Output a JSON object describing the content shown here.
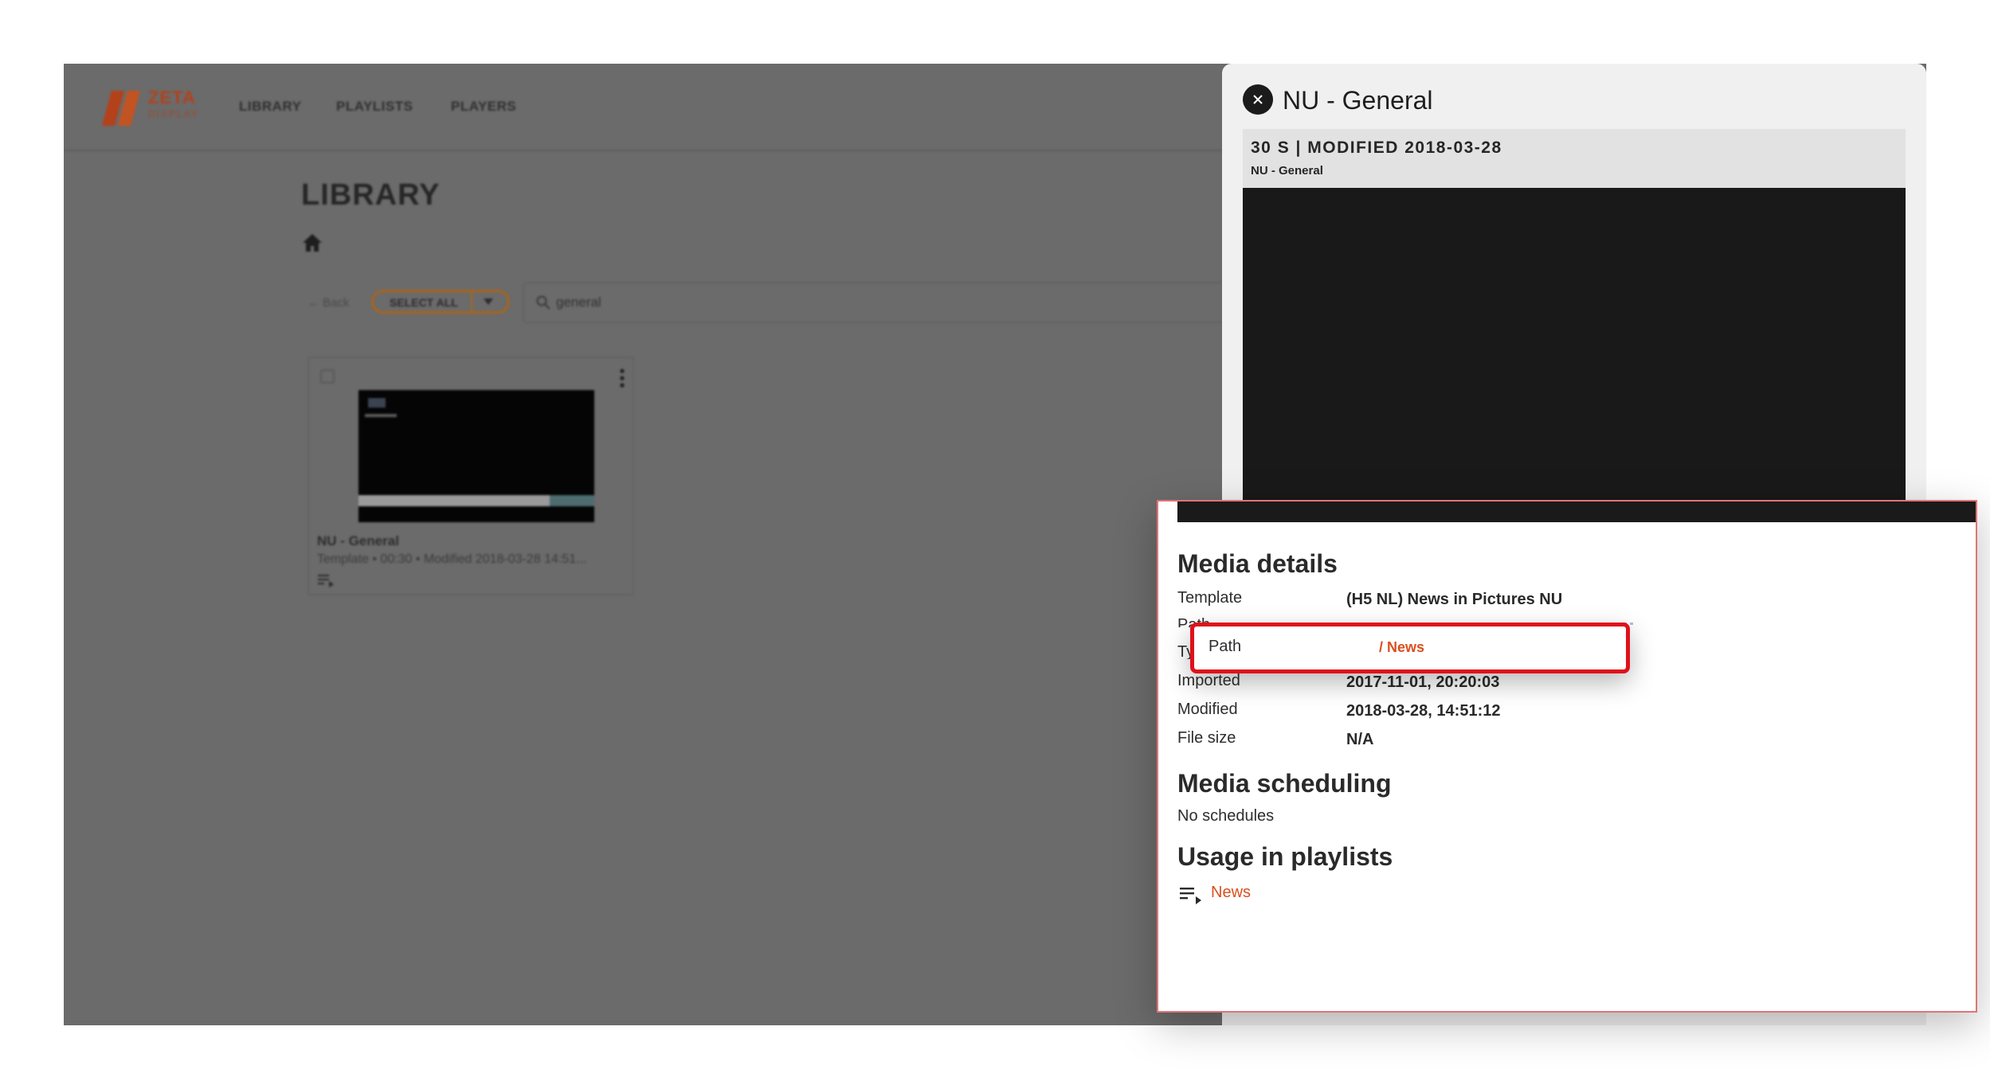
{
  "app": {
    "logo": {
      "text": "ZETA",
      "sub": "DISPLAY"
    },
    "nav": [
      "LIBRARY",
      "PLAYLISTS",
      "PLAYERS"
    ],
    "page_title": "LIBRARY",
    "toolbar": {
      "back_label": "Back",
      "select_all_label": "SELECT ALL"
    },
    "search": {
      "value": "general"
    },
    "card": {
      "title": "NU - General",
      "meta": "Template • 00:30 • Modified 2018-03-28 14:51..."
    }
  },
  "panel": {
    "title": "NU - General",
    "preview_meta": "30 S | MODIFIED 2018-03-28",
    "preview_sub": "NU - General"
  },
  "details": {
    "heading": "Media details",
    "template_label": "Template",
    "template_value": "(H5 NL) News in Pictures NU",
    "path_ghost": "Path",
    "type_ghost": "Ty",
    "imported_label": "Imported",
    "imported_value": "2017-11-01, 20:20:03",
    "modified_label": "Modified",
    "modified_value": "2018-03-28, 14:51:12",
    "filesize_label": "File size",
    "filesize_value": "N/A"
  },
  "highlight": {
    "label": "Path",
    "value": "/ News"
  },
  "scheduling": {
    "heading": "Media scheduling",
    "empty": "No schedules"
  },
  "usage": {
    "heading": "Usage in playlists",
    "items": [
      "News"
    ]
  },
  "colors": {
    "accent": "#d9501e",
    "highlight_border": "#e0101a",
    "overlay": "#6b6b6b"
  },
  "icons": [
    "zeta-logo-icon",
    "home-icon",
    "back-arrow-icon",
    "chevron-down-icon",
    "search-icon",
    "kebab-menu-icon",
    "playlist-icon",
    "close-icon"
  ]
}
